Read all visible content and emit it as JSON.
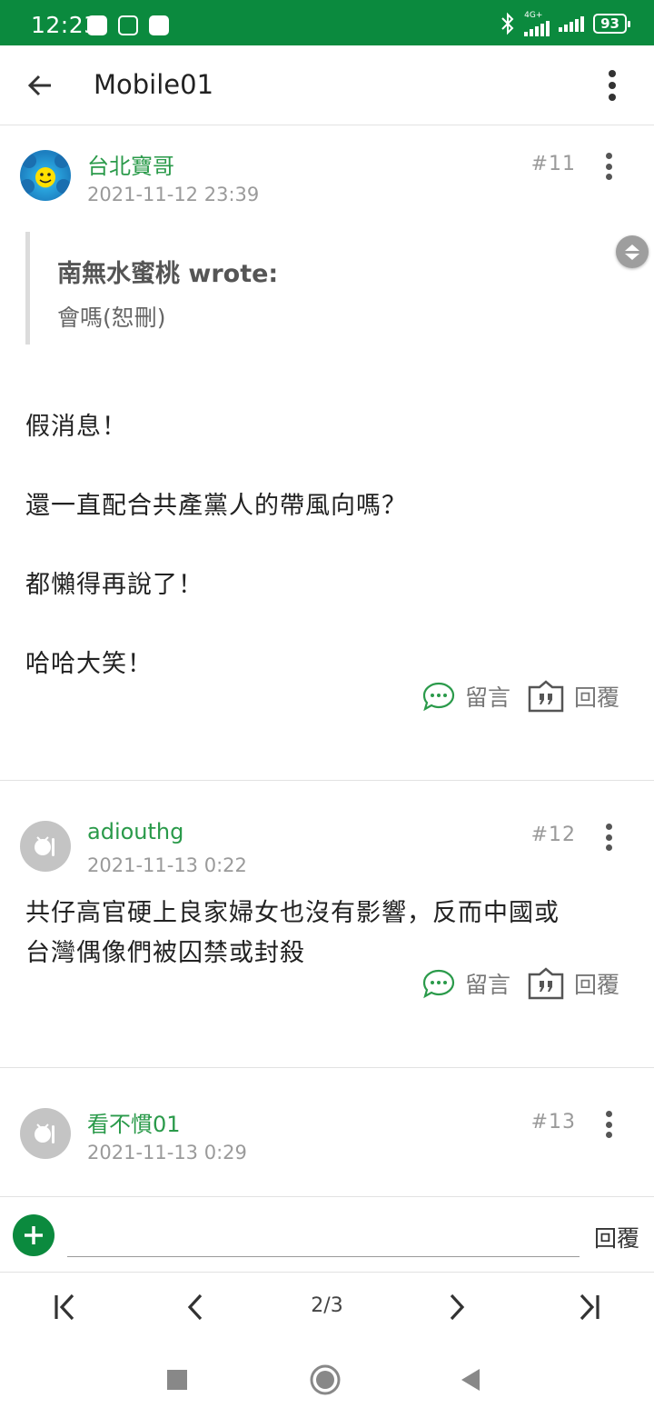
{
  "status_bar": {
    "time": "12:23",
    "network": "4G+",
    "battery": "93",
    "background_color": "#0b8a3e"
  },
  "app_bar": {
    "title": "Mobile01",
    "back_icon": "arrow-left-icon",
    "menu_icon": "more-vertical-icon"
  },
  "posts": [
    {
      "username": "台北寶哥",
      "timestamp": "2021-11-12 23:39",
      "floor": "#11",
      "quote": {
        "author": "南無水蜜桃 wrote:",
        "text": "會嗎(恕刪)"
      },
      "body": [
        "假消息！",
        "還一直配合共產黨人的帶風向嗎？",
        "都懶得再說了！",
        "哈哈大笑！"
      ],
      "comment_label": "留言",
      "reply_label": "回覆"
    },
    {
      "username": "adiouthg",
      "timestamp": "2021-11-13 0:22",
      "floor": "#12",
      "body": [
        "共仔高官硬上良家婦女也沒有影響，反而中國或",
        "台灣偶像們被囚禁或封殺"
      ],
      "comment_label": "留言",
      "reply_label": "回覆"
    },
    {
      "username": "看不慣01",
      "timestamp": "2021-11-13 0:29",
      "floor": "#13"
    }
  ],
  "reply_bar": {
    "input_value": "",
    "send_label": "回覆"
  },
  "pager": {
    "indicator": "2/3"
  },
  "accent_color": "#2a9a4a"
}
